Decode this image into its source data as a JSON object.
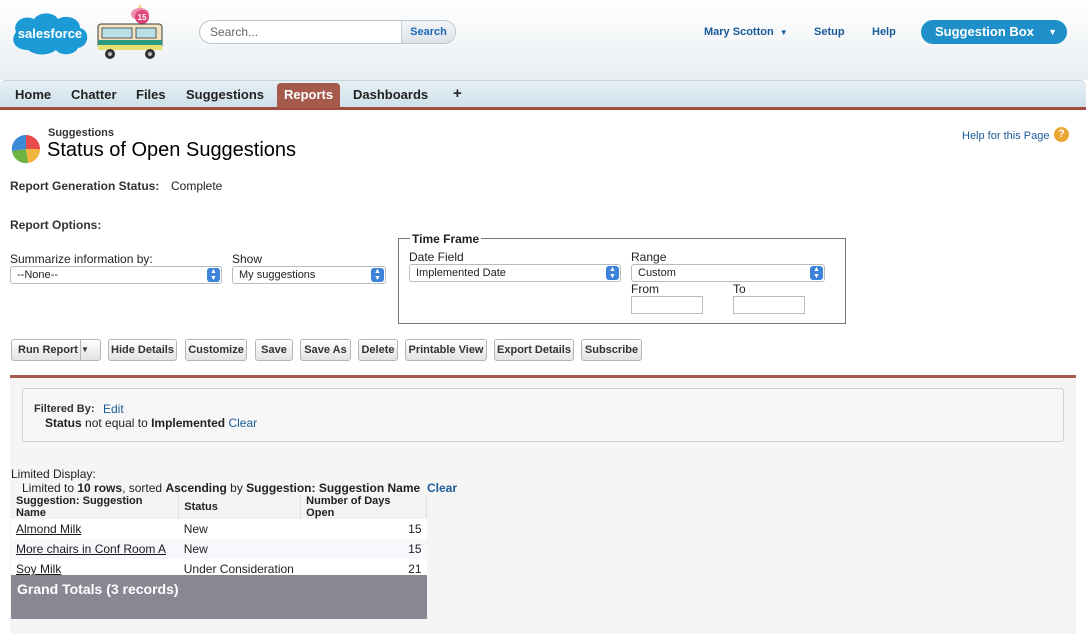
{
  "header": {
    "logo_text": "salesforce",
    "badge_number": "15",
    "search_placeholder": "Search...",
    "search_button": "Search",
    "user_name": "Mary Scotton",
    "setup": "Setup",
    "help": "Help",
    "app_name": "Suggestion Box"
  },
  "tabs": [
    {
      "label": "Home"
    },
    {
      "label": "Chatter"
    },
    {
      "label": "Files"
    },
    {
      "label": "Suggestions"
    },
    {
      "label": "Reports"
    },
    {
      "label": "Dashboards"
    },
    {
      "label": "+"
    }
  ],
  "page": {
    "type": "Suggestions",
    "title": "Status of Open Suggestions",
    "help_link": "Help for this Page"
  },
  "status": {
    "label": "Report Generation Status:",
    "value": "Complete"
  },
  "options": {
    "heading": "Report Options:",
    "summarize_label": "Summarize information by:",
    "summarize_value": "--None--",
    "show_label": "Show",
    "show_value": "My suggestions",
    "timeframe_legend": "Time Frame",
    "date_field_label": "Date Field",
    "date_field_value": "Implemented Date",
    "range_label": "Range",
    "range_value": "Custom",
    "from_label": "From",
    "to_label": "To"
  },
  "buttons": {
    "run_report": "Run Report",
    "hide_details": "Hide Details",
    "customize": "Customize",
    "save": "Save",
    "save_as": "Save As",
    "delete": "Delete",
    "printable_view": "Printable View",
    "export_details": "Export Details",
    "subscribe": "Subscribe"
  },
  "filter": {
    "label": "Filtered By:",
    "edit": "Edit",
    "field": "Status",
    "operator": "not equal to",
    "value": "Implemented",
    "clear": "Clear"
  },
  "limited": {
    "title": "Limited Display:",
    "prefix": "Limited to",
    "rows": "10 rows",
    "sorted": ", sorted",
    "direction": "Ascending",
    "by": "by",
    "field": "Suggestion: Suggestion Name",
    "clear": "Clear"
  },
  "table": {
    "columns": [
      "Suggestion: Suggestion Name",
      "Status",
      "Number of Days Open"
    ],
    "rows": [
      {
        "name": "Almond Milk",
        "status": "New",
        "days": "15"
      },
      {
        "name": "More chairs in Conf Room A",
        "status": "New",
        "days": "15"
      },
      {
        "name": "Soy Milk",
        "status": "Under Consideration",
        "days": "21"
      }
    ],
    "grand_totals": "Grand Totals (3 records)"
  }
}
